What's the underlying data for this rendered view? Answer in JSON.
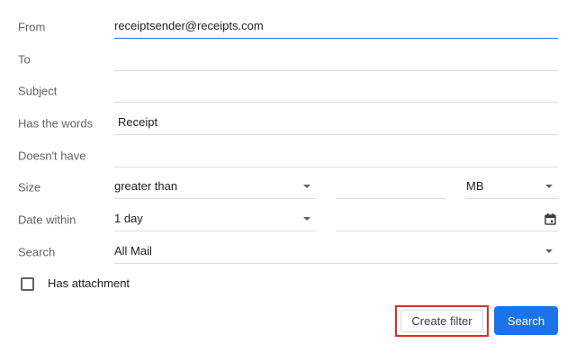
{
  "form": {
    "from": {
      "label": "From",
      "value": "receiptsender@receipts.com"
    },
    "to": {
      "label": "To",
      "value": ""
    },
    "subject": {
      "label": "Subject",
      "value": ""
    },
    "has_words": {
      "label": "Has the words",
      "value": "Receipt"
    },
    "doesnt_have": {
      "label": "Doesn't have",
      "value": ""
    },
    "size": {
      "label": "Size",
      "comparator": "greater than",
      "value": "",
      "unit": "MB"
    },
    "date_within": {
      "label": "Date within",
      "range": "1 day",
      "date": ""
    },
    "search": {
      "label": "Search",
      "scope": "All Mail"
    },
    "has_attachment": {
      "label": "Has attachment",
      "checked": false
    }
  },
  "buttons": {
    "create_filter": "Create filter",
    "search": "Search"
  },
  "colors": {
    "accent": "#1a73e8",
    "highlight_border": "#d93025",
    "label": "#5f6368",
    "divider": "#dadce0"
  },
  "icons": {
    "dropdown": "chevron-down-icon",
    "calendar": "calendar-icon"
  }
}
